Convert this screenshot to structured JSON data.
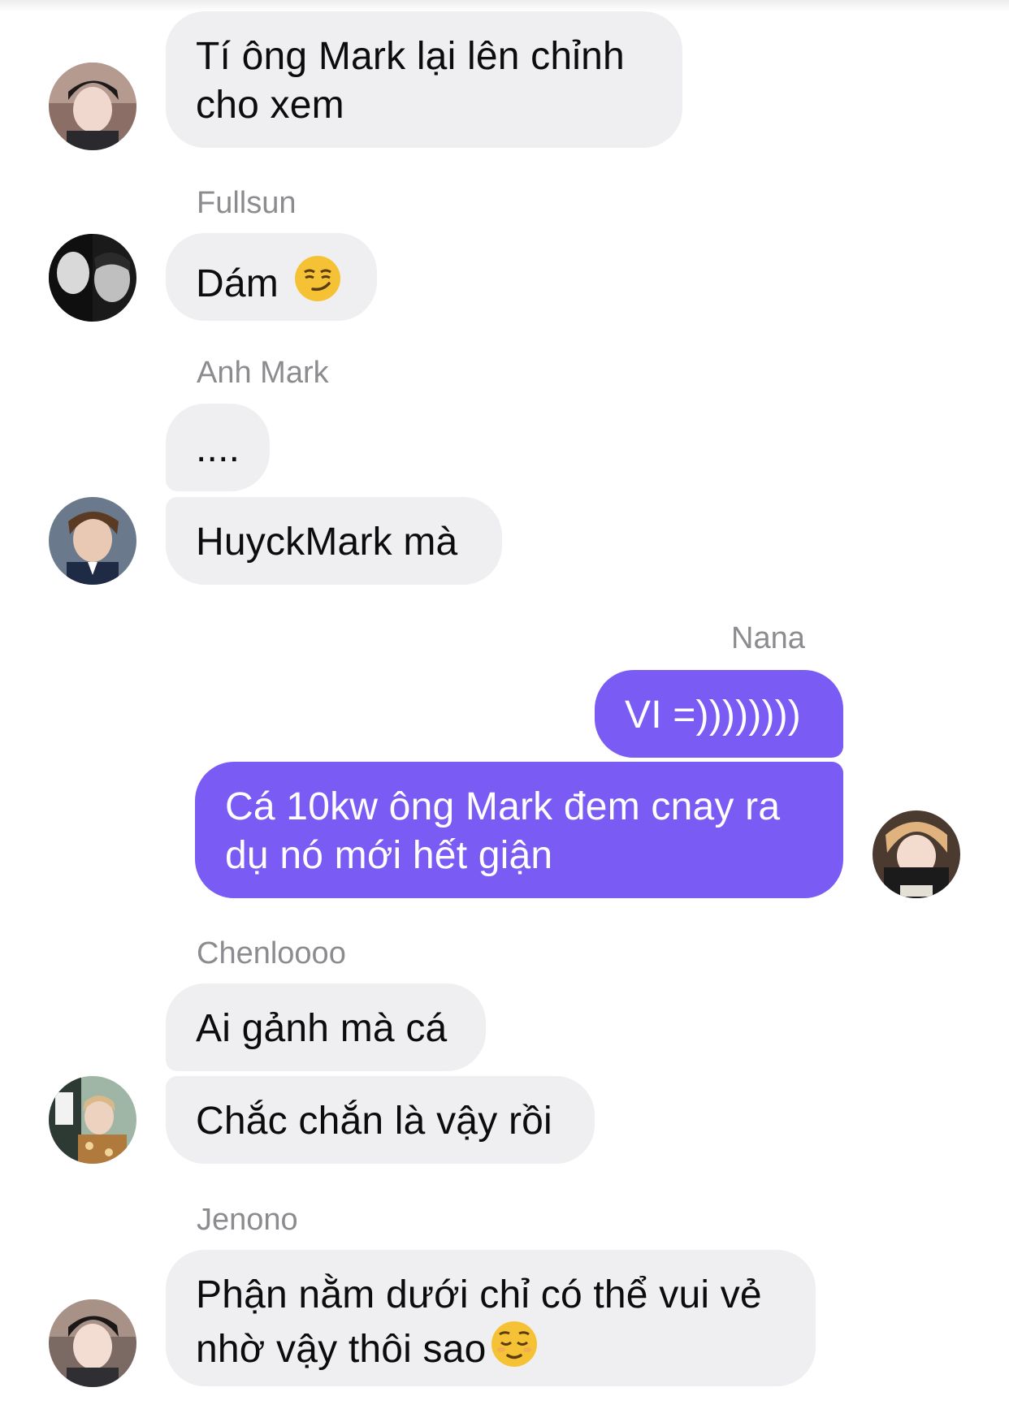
{
  "conversation": {
    "messages": [
      {
        "sender": "",
        "text_lines": [
          "Tí ông Mark lại lên chỉnh",
          "cho xem"
        ],
        "direction": "incoming"
      },
      {
        "sender": "Fullsun",
        "text_lines": [
          "Dám"
        ],
        "emoji": "smirking-face",
        "direction": "incoming"
      },
      {
        "sender": "Anh Mark",
        "text_lines": [
          "...."
        ],
        "direction": "incoming"
      },
      {
        "sender": "",
        "text_lines": [
          "HuyckMark mà"
        ],
        "direction": "incoming"
      },
      {
        "sender": "Nana",
        "text_lines": [
          "VI =))))))))"
        ],
        "direction": "outgoing"
      },
      {
        "sender": "",
        "text_lines": [
          "Cá 10kw ông Mark đem cnay ra",
          "dụ nó mới hết giận"
        ],
        "direction": "outgoing"
      },
      {
        "sender": "Chenloooo",
        "text_lines": [
          "Ai gảnh mà cá"
        ],
        "direction": "incoming"
      },
      {
        "sender": "",
        "text_lines": [
          "Chắc chắn là vậy rồi"
        ],
        "direction": "incoming"
      },
      {
        "sender": "Jenono",
        "text_lines": [
          "Phận nằm dưới chỉ có thể vui vẻ",
          "nhờ vậy thôi sao"
        ],
        "emoji": "relieved-face",
        "direction": "incoming"
      }
    ]
  },
  "colors": {
    "incoming_bubble": "#efeff1",
    "outgoing_bubble": "#7a5cf4",
    "sender_name": "#8c8c90"
  }
}
